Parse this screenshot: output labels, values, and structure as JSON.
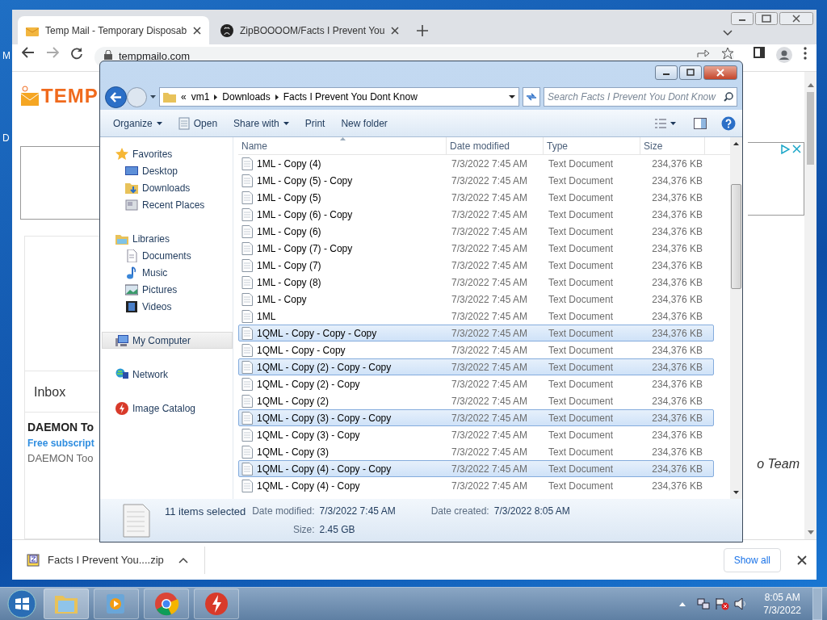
{
  "desktop_labels": [
    "M",
    "D"
  ],
  "browser": {
    "tabs": [
      {
        "title": "Temp Mail - Temporary Disposab",
        "selected": true
      },
      {
        "title": "ZipBOOOOM/Facts I Prevent You",
        "selected": false
      }
    ],
    "address": "tempmailo.com",
    "page": {
      "logo": "TEMP",
      "inbox": "Inbox",
      "mail_sender": "DAEMON To",
      "mail_subject": "Free subscript",
      "mail_preview": "DAEMON Too",
      "team_text": "o Team"
    },
    "download": {
      "filename": "Facts I Prevent You....zip",
      "show_all": "Show all"
    }
  },
  "explorer": {
    "overflow_mark": "«",
    "breadcrumb": [
      "vm1",
      "Downloads",
      "Facts I Prevent You Dont Know"
    ],
    "search": {
      "placeholder": "Search Facts I Prevent You Dont Know"
    },
    "commands": [
      {
        "label": "Organize",
        "kind": "dropdown"
      },
      {
        "label": "Open",
        "kind": "open"
      },
      {
        "label": "Share with",
        "kind": "dropdown"
      },
      {
        "label": "Print",
        "kind": "plain"
      },
      {
        "label": "New folder",
        "kind": "plain"
      }
    ],
    "nav": [
      {
        "label": "Favorites",
        "kind": "star",
        "selected": false,
        "children": [
          {
            "label": "Desktop",
            "kind": "desktop",
            "selected": false
          },
          {
            "label": "Downloads",
            "kind": "downloads",
            "selected": false
          },
          {
            "label": "Recent Places",
            "kind": "recent",
            "selected": false
          }
        ]
      },
      {
        "label": "Libraries",
        "kind": "library",
        "selected": false,
        "children": [
          {
            "label": "Documents",
            "kind": "document",
            "selected": false
          },
          {
            "label": "Music",
            "kind": "music",
            "selected": false
          },
          {
            "label": "Pictures",
            "kind": "pictures",
            "selected": false
          },
          {
            "label": "Videos",
            "kind": "videos",
            "selected": false
          }
        ]
      },
      {
        "label": "My Computer",
        "kind": "computer",
        "selected": true
      },
      {
        "label": "Network",
        "kind": "network",
        "selected": false
      },
      {
        "label": "Image Catalog",
        "kind": "catalog",
        "selected": false
      }
    ],
    "columns": [
      {
        "label": "Name",
        "sorted": true
      },
      {
        "label": "Date modified",
        "sorted": false
      },
      {
        "label": "Type",
        "sorted": false
      },
      {
        "label": "Size",
        "sorted": false
      }
    ],
    "files": [
      {
        "name": "1ML - Copy (4)",
        "date": "7/3/2022 7:45 AM",
        "type": "Text Document",
        "size": "234,376 KB",
        "selected": false
      },
      {
        "name": "1ML - Copy (5) - Copy",
        "date": "7/3/2022 7:45 AM",
        "type": "Text Document",
        "size": "234,376 KB",
        "selected": false
      },
      {
        "name": "1ML - Copy (5)",
        "date": "7/3/2022 7:45 AM",
        "type": "Text Document",
        "size": "234,376 KB",
        "selected": false
      },
      {
        "name": "1ML - Copy (6) - Copy",
        "date": "7/3/2022 7:45 AM",
        "type": "Text Document",
        "size": "234,376 KB",
        "selected": false
      },
      {
        "name": "1ML - Copy (6)",
        "date": "7/3/2022 7:45 AM",
        "type": "Text Document",
        "size": "234,376 KB",
        "selected": false
      },
      {
        "name": "1ML - Copy (7) - Copy",
        "date": "7/3/2022 7:45 AM",
        "type": "Text Document",
        "size": "234,376 KB",
        "selected": false
      },
      {
        "name": "1ML - Copy (7)",
        "date": "7/3/2022 7:45 AM",
        "type": "Text Document",
        "size": "234,376 KB",
        "selected": false
      },
      {
        "name": "1ML - Copy (8)",
        "date": "7/3/2022 7:45 AM",
        "type": "Text Document",
        "size": "234,376 KB",
        "selected": false
      },
      {
        "name": "1ML - Copy",
        "date": "7/3/2022 7:45 AM",
        "type": "Text Document",
        "size": "234,376 KB",
        "selected": false
      },
      {
        "name": "1ML",
        "date": "7/3/2022 7:45 AM",
        "type": "Text Document",
        "size": "234,376 KB",
        "selected": false
      },
      {
        "name": "1QML - Copy - Copy - Copy",
        "date": "7/3/2022 7:45 AM",
        "type": "Text Document",
        "size": "234,376 KB",
        "selected": true
      },
      {
        "name": "1QML - Copy - Copy",
        "date": "7/3/2022 7:45 AM",
        "type": "Text Document",
        "size": "234,376 KB",
        "selected": false
      },
      {
        "name": "1QML - Copy (2) - Copy - Copy",
        "date": "7/3/2022 7:45 AM",
        "type": "Text Document",
        "size": "234,376 KB",
        "selected": true
      },
      {
        "name": "1QML - Copy (2) - Copy",
        "date": "7/3/2022 7:45 AM",
        "type": "Text Document",
        "size": "234,376 KB",
        "selected": false
      },
      {
        "name": "1QML - Copy (2)",
        "date": "7/3/2022 7:45 AM",
        "type": "Text Document",
        "size": "234,376 KB",
        "selected": false
      },
      {
        "name": "1QML - Copy (3) - Copy - Copy",
        "date": "7/3/2022 7:45 AM",
        "type": "Text Document",
        "size": "234,376 KB",
        "selected": true
      },
      {
        "name": "1QML - Copy (3) - Copy",
        "date": "7/3/2022 7:45 AM",
        "type": "Text Document",
        "size": "234,376 KB",
        "selected": false
      },
      {
        "name": "1QML - Copy (3)",
        "date": "7/3/2022 7:45 AM",
        "type": "Text Document",
        "size": "234,376 KB",
        "selected": false
      },
      {
        "name": "1QML - Copy (4) - Copy - Copy",
        "date": "7/3/2022 7:45 AM",
        "type": "Text Document",
        "size": "234,376 KB",
        "selected": true
      },
      {
        "name": "1QML - Copy (4) - Copy",
        "date": "7/3/2022 7:45 AM",
        "type": "Text Document",
        "size": "234,376 KB",
        "selected": false
      }
    ],
    "details": {
      "summary": "11 items selected",
      "fields": [
        {
          "label": "Date modified:",
          "value": "7/3/2022 7:45 AM"
        },
        {
          "label": "Date created:",
          "value": "7/3/2022 8:05 AM"
        },
        {
          "label": "Size:",
          "value": "2.45 GB"
        }
      ]
    }
  },
  "taskbar": {
    "time": "8:05 AM",
    "date": "7/3/2022"
  }
}
